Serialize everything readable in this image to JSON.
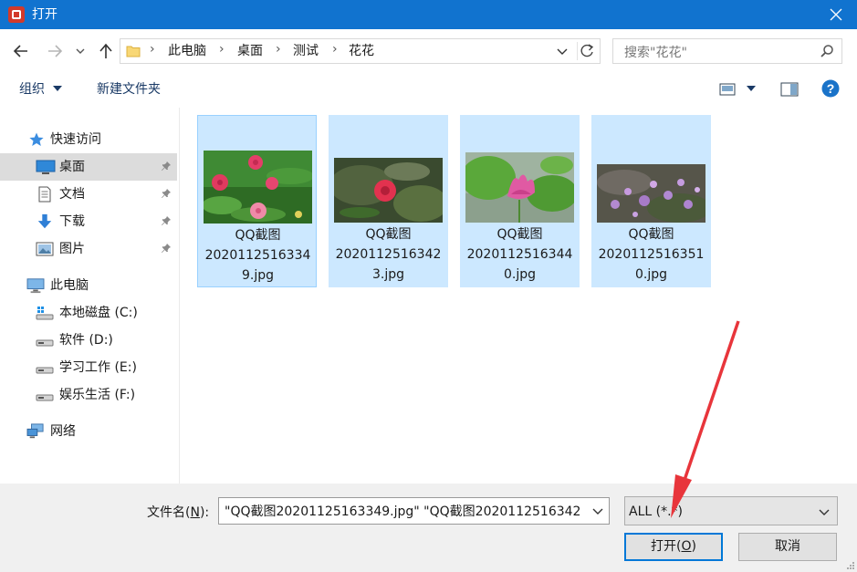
{
  "window": {
    "title": "打开"
  },
  "address": {
    "crumbs": [
      "此电脑",
      "桌面",
      "测试",
      "花花"
    ]
  },
  "search": {
    "placeholder": "搜索\"花花\""
  },
  "toolbar": {
    "organize_label": "组织",
    "new_folder_label": "新建文件夹"
  },
  "sidebar": {
    "quick_access": "快速访问",
    "items": [
      {
        "label": "桌面",
        "icon": "desktop-icon",
        "pinned": true,
        "selected": true
      },
      {
        "label": "文档",
        "icon": "document-icon",
        "pinned": true
      },
      {
        "label": "下载",
        "icon": "download-icon",
        "pinned": true
      },
      {
        "label": "图片",
        "icon": "picture-icon",
        "pinned": true
      }
    ],
    "this_pc": "此电脑",
    "drives": [
      {
        "label": "本地磁盘 (C:)",
        "icon": "system-drive-icon"
      },
      {
        "label": "软件 (D:)",
        "icon": "drive-icon"
      },
      {
        "label": "学习工作 (E:)",
        "icon": "drive-icon"
      },
      {
        "label": "娱乐生活 (F:)",
        "icon": "drive-icon"
      }
    ],
    "network": "网络"
  },
  "files": [
    {
      "line1": "QQ截图",
      "line2": "2020112516334",
      "line3": "9.jpg",
      "selected": true,
      "focused": true
    },
    {
      "line1": "QQ截图",
      "line2": "2020112516342",
      "line3": "3.jpg",
      "selected": true
    },
    {
      "line1": "QQ截图",
      "line2": "2020112516344",
      "line3": "0.jpg",
      "selected": true
    },
    {
      "line1": "QQ截图",
      "line2": "2020112516351",
      "line3": "0.jpg",
      "selected": true
    }
  ],
  "bottom": {
    "filename_label_prefix": "文件名(",
    "filename_label_key": "N",
    "filename_label_suffix": "):",
    "filename_value": "\"QQ截图20201125163349.jpg\" \"QQ截图2020112516342",
    "filetype_value": "ALL (*.*)",
    "open_prefix": "打开(",
    "open_key": "O",
    "open_suffix": ")",
    "cancel_label": "取消"
  },
  "colors": {
    "titlebar": "#1173cf",
    "selection": "#cce8ff",
    "accent": "#0078d7",
    "annotation": "#e8353b"
  }
}
